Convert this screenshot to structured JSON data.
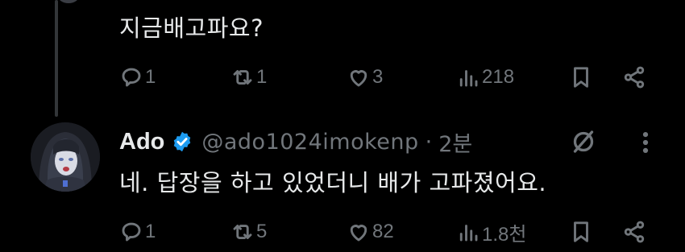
{
  "tweet_top": {
    "text": "지금배고파요?",
    "replies": "1",
    "reposts": "1",
    "likes": "3",
    "views": "218"
  },
  "tweet_reply": {
    "name": "Ado",
    "handle": "@ado1024imokenp",
    "separator": "·",
    "time": "2분",
    "text": "네. 답장을 하고 있었더니 배가 고파졌어요.",
    "replies": "1",
    "reposts": "5",
    "likes": "82",
    "views": "1.8천"
  },
  "colors": {
    "background": "#000000",
    "text": "#e7e9ea",
    "muted": "#71767b",
    "verified": "#1d9bf0",
    "thread_line": "#333639"
  },
  "icons": {
    "reply": "reply-icon",
    "repost": "repost-icon",
    "like": "heart-icon",
    "views": "views-icon",
    "bookmark": "bookmark-icon",
    "share": "share-icon",
    "verified": "verified-badge-icon",
    "grok": "grok-icon",
    "more": "more-icon"
  }
}
